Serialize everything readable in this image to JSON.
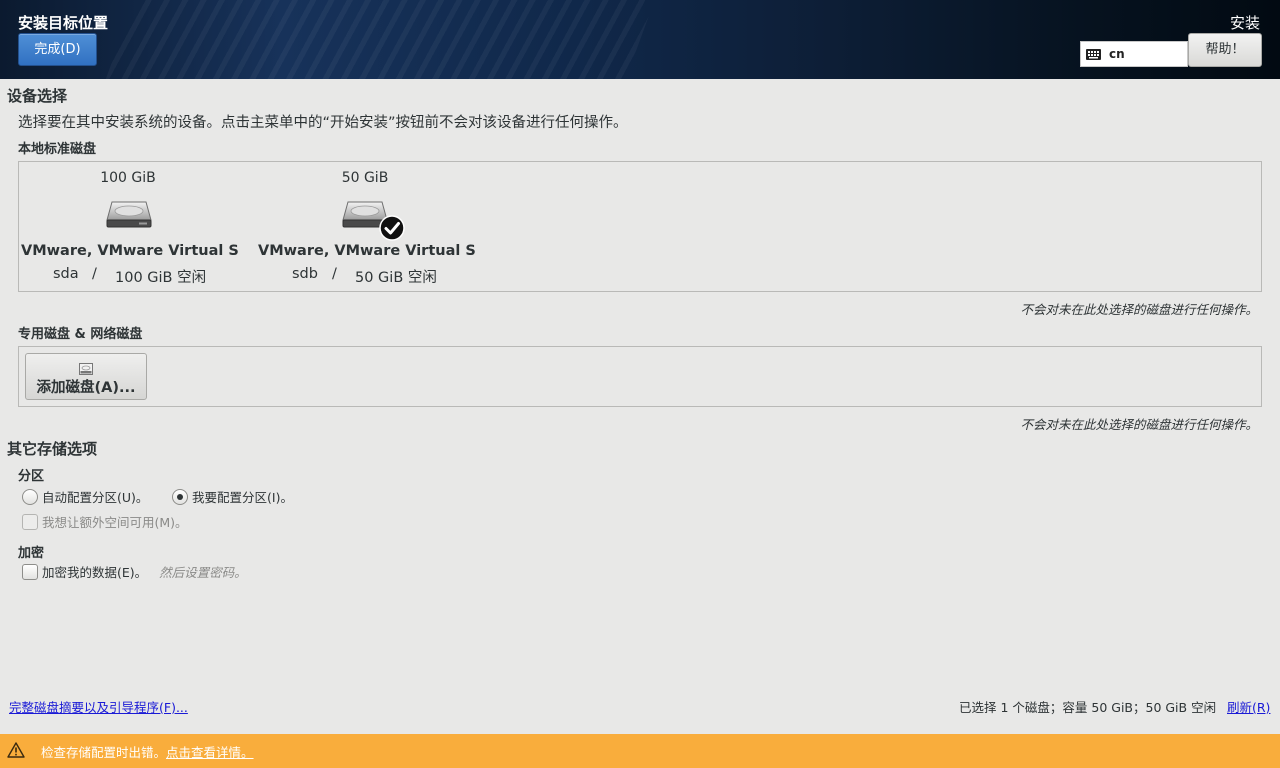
{
  "header": {
    "title": "安装目标位置",
    "done_label": "完成(D)",
    "product": "安装",
    "keyboard_layout": "cn",
    "help_label": "帮助！"
  },
  "device_selection": {
    "title": "设备选择",
    "description": "选择要在其中安装系统的设备。点击主菜单中的“开始安装”按钮前不会对该设备进行任何操作。",
    "local_disks_label": "本地标准磁盘",
    "disks": [
      {
        "size": "100 GiB",
        "name": "VMware, VMware Virtual S",
        "device": "sda",
        "separator": "/",
        "free": "100 GiB 空闲",
        "selected": false
      },
      {
        "size": "50 GiB",
        "name": "VMware, VMware Virtual S",
        "device": "sdb",
        "separator": "/",
        "free": "50 GiB 空闲",
        "selected": true
      }
    ],
    "local_note": "不会对未在此处选择的磁盘进行任何操作。",
    "special_disks_label": "专用磁盘 & 网络磁盘",
    "add_disk_label": "添加磁盘(A)...",
    "special_note": "不会对未在此处选择的磁盘进行任何操作。"
  },
  "other_storage": {
    "title": "其它存储选项",
    "partition_label": "分区",
    "auto_partition": "自动配置分区(U)。",
    "manual_partition": "我要配置分区(I)。",
    "extra_space": "我想让额外空间可用(M)。",
    "encryption_label": "加密",
    "encrypt_data": "加密我的数据(E)。",
    "encrypt_hint": "然后设置密码。"
  },
  "footer": {
    "summary_link": "完整磁盘摘要以及引导程序(F)...",
    "selection_summary": "已选择 1 个磁盘；容量 50 GiB；50 GiB 空闲",
    "refresh_link": "刷新(R)"
  },
  "warning": {
    "message": "检查存储配置时出错。",
    "details_link": "点击查看详情。"
  }
}
